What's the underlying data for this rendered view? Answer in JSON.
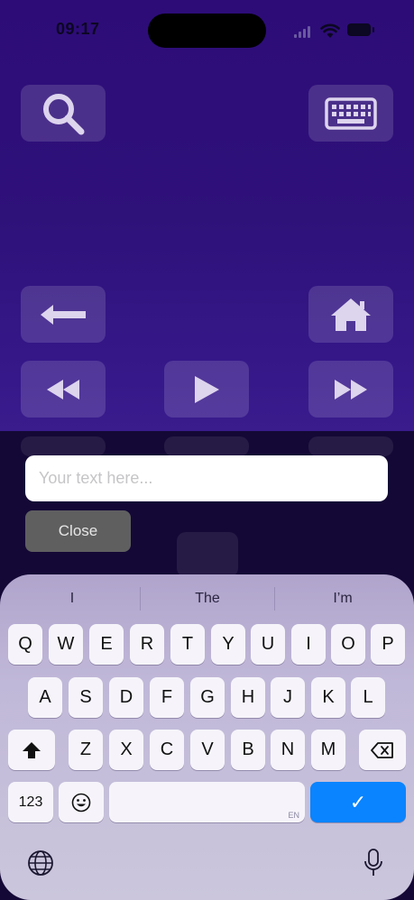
{
  "status_bar": {
    "time": "09:17"
  },
  "remote": {
    "search_icon": "search-icon",
    "keyboard_icon": "keyboard-icon",
    "back_icon": "back-arrow-icon",
    "home_icon": "home-icon",
    "rewind_icon": "rewind-icon",
    "play_icon": "play-icon",
    "fast_forward_icon": "fast-forward-icon"
  },
  "text_entry": {
    "placeholder": "Your text here...",
    "close_label": "Close"
  },
  "keyboard": {
    "suggestions": [
      "I",
      "The",
      "I’m"
    ],
    "row1": [
      "Q",
      "W",
      "E",
      "R",
      "T",
      "Y",
      "U",
      "I",
      "O",
      "P"
    ],
    "row2": [
      "A",
      "S",
      "D",
      "F",
      "G",
      "H",
      "J",
      "K",
      "L"
    ],
    "row3": [
      "Z",
      "X",
      "C",
      "V",
      "B",
      "N",
      "M"
    ],
    "numbers_label": "123",
    "language_tag": "EN",
    "done_label": "✓"
  },
  "colors": {
    "accent": "#0a84ff",
    "background": "#2d0c78"
  }
}
